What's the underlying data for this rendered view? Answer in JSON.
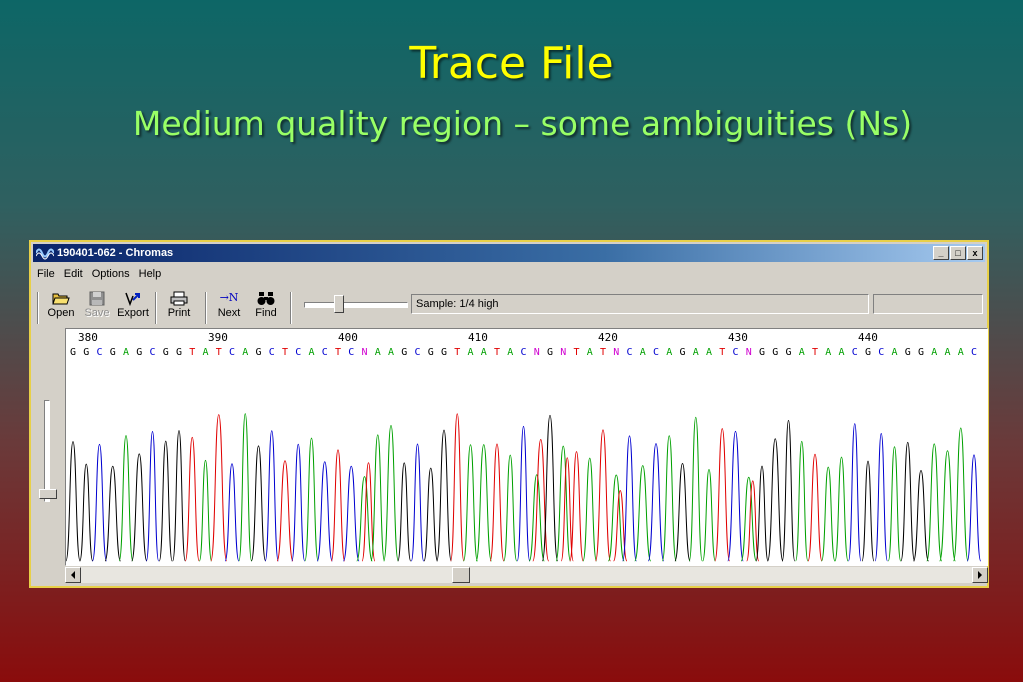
{
  "slide": {
    "title": "Trace File",
    "subtitle": "Medium quality region – some ambiguities (Ns)"
  },
  "window": {
    "title": "190401-062 - Chromas",
    "controls": {
      "minimize": "_",
      "maximize": "□",
      "close": "x"
    },
    "menu": [
      "File",
      "Edit",
      "Options",
      "Help"
    ],
    "toolbar": {
      "open": "Open",
      "save": "Save",
      "export": "Export",
      "print": "Print",
      "next": "Next",
      "find": "Find"
    },
    "next_icon_text": "→N",
    "sample_text": "Sample: 1/4 high"
  },
  "base_colors": {
    "A": "#00a000",
    "C": "#0000d0",
    "G": "#000000",
    "T": "#e00000",
    "N": "#d000d0"
  },
  "trace": {
    "position_labels": [
      "380",
      "390",
      "400",
      "410",
      "420",
      "430",
      "440"
    ],
    "sequence": [
      "G",
      "G",
      "C",
      "G",
      "A",
      "G",
      "C",
      "G",
      "G",
      "T",
      "A",
      "T",
      "C",
      "A",
      "G",
      "C",
      "T",
      "C",
      "A",
      "C",
      "T",
      "C",
      "N",
      "A",
      "A",
      "G",
      "C",
      "G",
      "G",
      "T",
      "A",
      "A",
      "T",
      "A",
      "C",
      "N",
      "G",
      "N",
      "T",
      "A",
      "T",
      "N",
      "C",
      "A",
      "C",
      "A",
      "G",
      "A",
      "A",
      "T",
      "C",
      "N",
      "G",
      "G",
      "G",
      "A",
      "T",
      "A",
      "A",
      "C",
      "G",
      "C",
      "A",
      "G",
      "G",
      "A",
      "A",
      "A",
      "C"
    ]
  }
}
